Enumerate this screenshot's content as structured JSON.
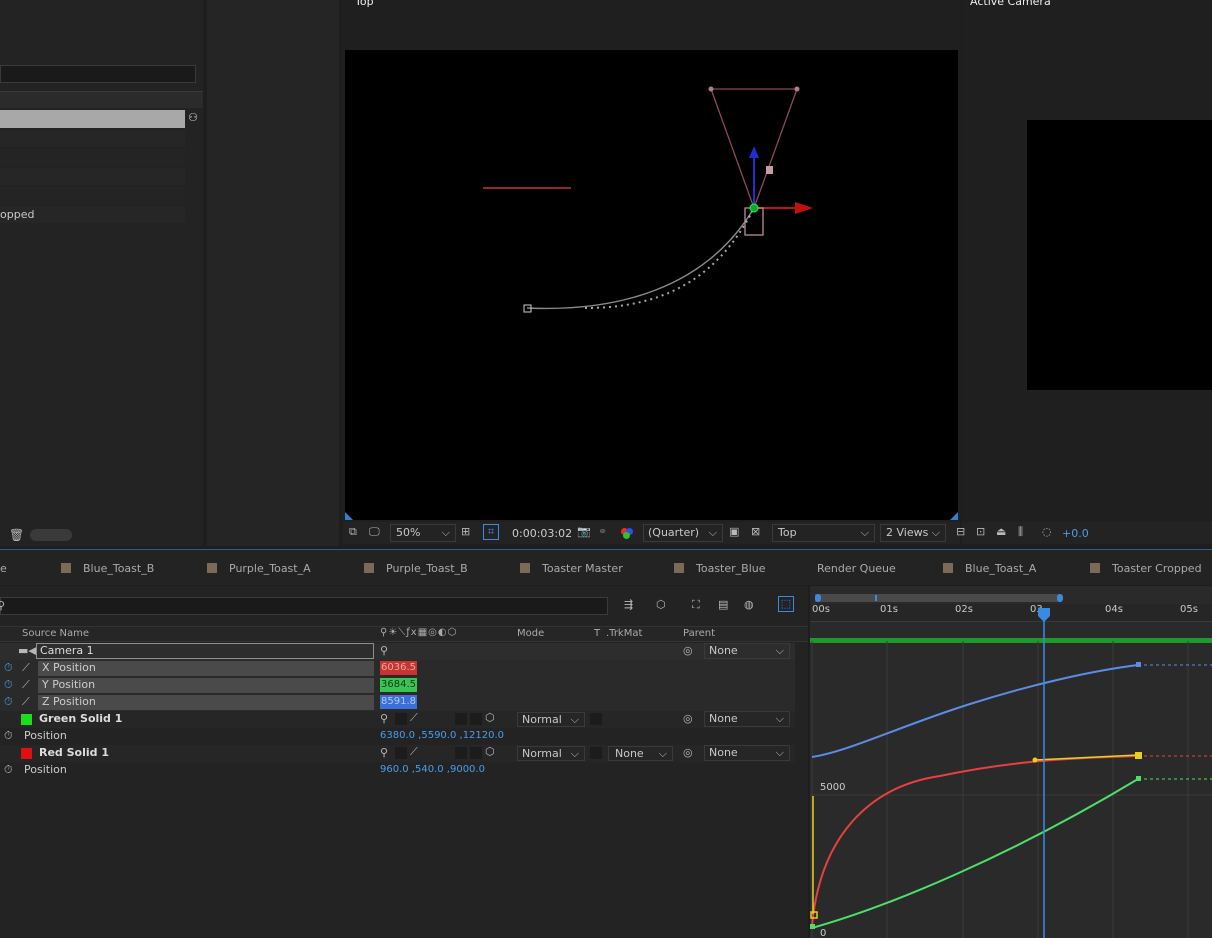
{
  "viewer_top": {
    "title": "Top",
    "toolbar": {
      "zoom": "50%",
      "timecode": "0:00:03:02",
      "resolution": "(Quarter)",
      "view": "Top",
      "views": "2 Views",
      "exposure": "+0.0"
    }
  },
  "viewer_active": {
    "title": "Active Camera"
  },
  "project": {
    "items": [
      "",
      "",
      "",
      "",
      "",
      "opped"
    ]
  },
  "tabs": [
    "e",
    "Blue_Toast_B",
    "Purple_Toast_A",
    "Purple_Toast_B",
    "Toaster Master",
    "Toaster_Blue",
    "Render Queue",
    "Blue_Toast_A",
    "Toaster Cropped"
  ],
  "timeline": {
    "search_placeholder": "",
    "columns": {
      "source_name": "Source Name",
      "mode": "Mode",
      "t": "T",
      "trkmat": ".TrkMat",
      "parent": "Parent"
    },
    "camera": {
      "name": "Camera 1",
      "parent": "None"
    },
    "camera_props": [
      {
        "name": "X Position",
        "value": "6036.5",
        "color": "#c8342f"
      },
      {
        "name": "Y Position",
        "value": "3684.5",
        "color": "#39c455"
      },
      {
        "name": "Z Position",
        "value": "8591.8",
        "color": "#3c6fd8"
      }
    ],
    "layers": [
      {
        "name": "Green Solid 1",
        "color": "#19e019",
        "mode": "Normal",
        "trkmat": "",
        "parent": "None",
        "prop": "Position",
        "prop_value": "6380.0 ,5590.0 ,12120.0"
      },
      {
        "name": "Red Solid 1",
        "color": "#e01010",
        "mode": "Normal",
        "trkmat": "None",
        "parent": "None",
        "prop": "Position",
        "prop_value": "960.0 ,540.0 ,9000.0"
      }
    ],
    "ruler": [
      "00s",
      "01s",
      "02s",
      "03",
      "04s",
      "05s"
    ],
    "graph_labels": [
      "5000",
      "0"
    ]
  }
}
